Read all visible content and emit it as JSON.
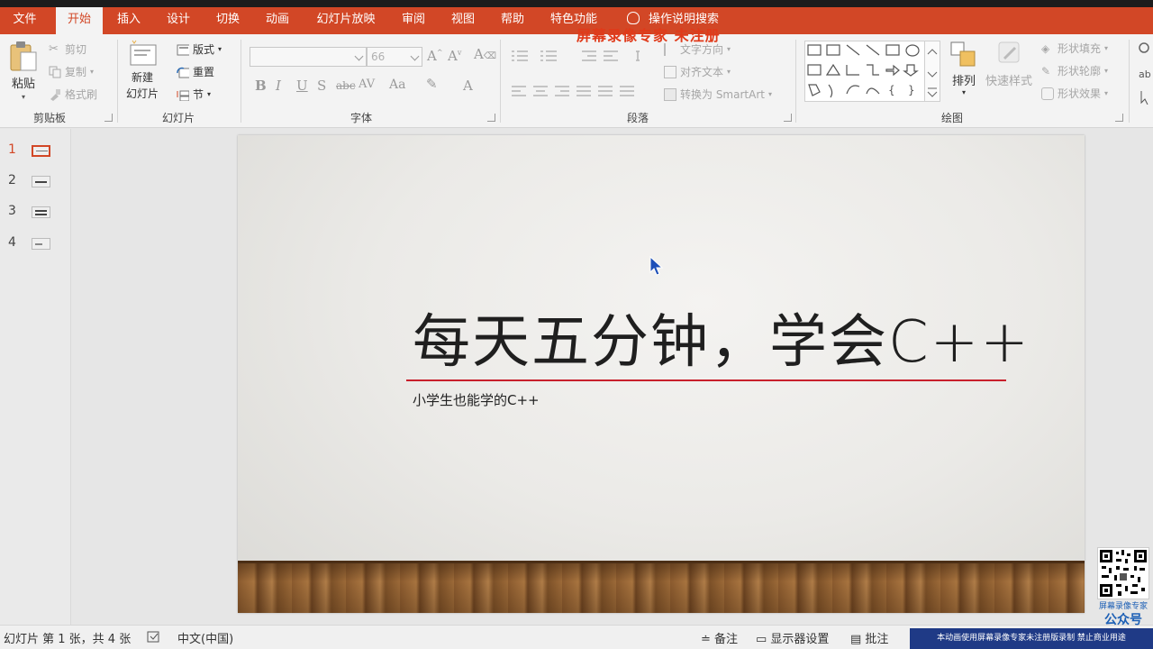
{
  "tabs": [
    {
      "label": "文件",
      "active": false
    },
    {
      "label": "开始",
      "active": true
    },
    {
      "label": "插入",
      "active": false
    },
    {
      "label": "设计",
      "active": false
    },
    {
      "label": "切换",
      "active": false
    },
    {
      "label": "动画",
      "active": false
    },
    {
      "label": "幻灯片放映",
      "active": false
    },
    {
      "label": "审阅",
      "active": false
    },
    {
      "label": "视图",
      "active": false
    },
    {
      "label": "帮助",
      "active": false
    },
    {
      "label": "特色功能",
      "active": false
    }
  ],
  "tell_me": "操作说明搜索",
  "top_watermark": "屏幕录像专家 未注册",
  "ribbon": {
    "clipboard": {
      "paste": "粘贴",
      "cut": "剪切",
      "copy": "复制",
      "format_painter": "格式刷",
      "label": "剪贴板"
    },
    "slides": {
      "new_line1": "新建",
      "new_line2": "幻灯片",
      "layout": "版式",
      "reset": "重置",
      "section": "节",
      "label": "幻灯片"
    },
    "font": {
      "font_name": "",
      "font_size": "66",
      "bold": "B",
      "italic": "I",
      "underline": "U",
      "shadow": "S",
      "strike": "abc",
      "spacing": "AV",
      "case": "Aa",
      "color": "A",
      "label": "字体"
    },
    "paragraph": {
      "text_direction": "文字方向",
      "align_text": "对齐文本",
      "smartart": "转换为 SmartArt",
      "label": "段落"
    },
    "drawing": {
      "arrange": "排列",
      "quick_styles": "快速样式",
      "shape_fill": "形状填充",
      "shape_outline": "形状轮廓",
      "shape_effects": "形状效果",
      "label": "绘图"
    }
  },
  "thumbnails": [
    {
      "num": "1",
      "active": true
    },
    {
      "num": "2",
      "active": false
    },
    {
      "num": "3",
      "active": false
    },
    {
      "num": "4",
      "active": false
    }
  ],
  "slide": {
    "title": "每天五分钟，学会C++",
    "subtitle": "小学生也能学的C++"
  },
  "status": {
    "slide_info": "幻灯片 第 1 张，共 4 张",
    "language": "中文(中国)",
    "notes": "备注",
    "display_settings": "显示器设置",
    "comments": "批注",
    "bottom_watermark": "本动画使用屏幕录像专家未注册版录制  禁止商业用途"
  },
  "qr": {
    "caption1": "屏幕录像专家",
    "caption2": "公众号"
  },
  "colors": {
    "accent": "#d24726",
    "title_rule": "#c8202c"
  }
}
